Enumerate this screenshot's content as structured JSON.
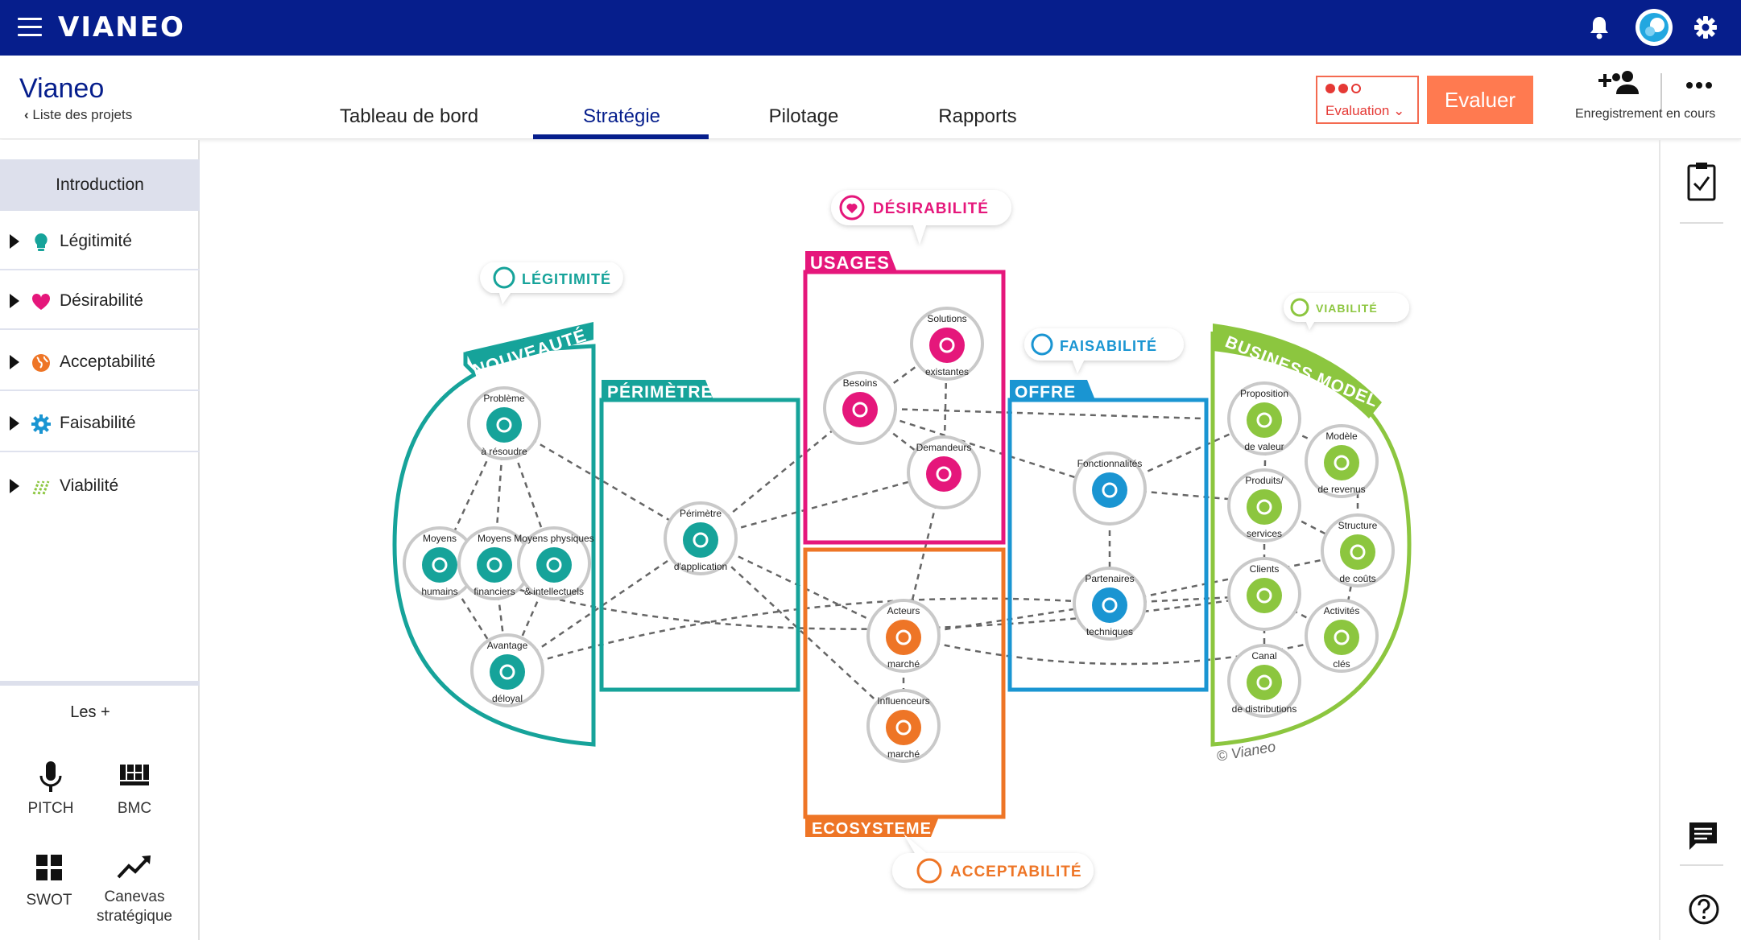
{
  "app": {
    "logo": "VIANEO"
  },
  "project": {
    "title": "Vianeo",
    "back_link": "Liste des projets"
  },
  "tabs": [
    {
      "label": "Tableau de bord"
    },
    {
      "label": "Stratégie"
    },
    {
      "label": "Pilotage"
    },
    {
      "label": "Rapports"
    }
  ],
  "active_tab": "Stratégie",
  "evaluation": {
    "label": "Evaluation",
    "level": 2,
    "max": 3
  },
  "evaluer_button": "Evaluer",
  "save_status": "Enregistrement en cours",
  "colors": {
    "brand": "#061e8c",
    "legitimite": "#16a39a",
    "desirabilite": "#e5177b",
    "acceptabilite": "#ee7526",
    "faisabilite": "#1a95d2",
    "viabilite": "#8cc63f",
    "accent": "#ff7a50"
  },
  "sidebar": {
    "intro": "Introduction",
    "items": [
      {
        "label": "Légitimité",
        "icon": "lightbulb-icon"
      },
      {
        "label": "Désirabilité",
        "icon": "heart-icon"
      },
      {
        "label": "Acceptabilité",
        "icon": "globe-icon"
      },
      {
        "label": "Faisabilité",
        "icon": "gear-icon"
      },
      {
        "label": "Viabilité",
        "icon": "sprout-icon"
      }
    ],
    "extras_title": "Les +",
    "tools": [
      {
        "label": "PITCH",
        "icon": "microphone-icon"
      },
      {
        "label": "BMC",
        "icon": "bmc-grid-icon"
      },
      {
        "label": "SWOT",
        "icon": "swot-grid-icon"
      },
      {
        "label": "Canevas stratégique",
        "icon": "trend-icon"
      }
    ]
  },
  "diagram": {
    "pillars": {
      "legitimite": "LÉGITIMITÉ",
      "desirabilite": "DÉSIRABILITÉ",
      "faisabilite": "FAISABILITÉ",
      "viabilite": "VIABILITÉ",
      "acceptabilite": "ACCEPTABILITÉ"
    },
    "blocks": {
      "nouveaute": "NOUVEAUTÉ",
      "perimetre": "PÉRIMÈTRE",
      "usages": "USAGES",
      "offre": "OFFRE",
      "business_model": "BUSINESS MODEL",
      "ecosysteme": "ECOSYSTEME"
    },
    "nodes": {
      "probleme": [
        "Problème",
        "à résoudre"
      ],
      "moyens_humains": [
        "Moyens",
        "humains"
      ],
      "moyens_financiers": [
        "Moyens",
        "financiers"
      ],
      "moyens_physiques": [
        "Moyens physiques",
        "& intellectuels"
      ],
      "avantage": [
        "Avantage",
        "déloyal"
      ],
      "perimetre_app": [
        "Périmètre",
        "d'application"
      ],
      "solutions": [
        "Solutions",
        "existantes"
      ],
      "besoins": [
        "Besoins",
        ""
      ],
      "demandeurs": [
        "Demandeurs",
        ""
      ],
      "acteurs": [
        "Acteurs",
        "marché"
      ],
      "influenceurs": [
        "Influenceurs",
        "marché"
      ],
      "fonctionnalites": [
        "Fonctionnalités",
        ""
      ],
      "partenaires": [
        "Partenaires",
        "techniques"
      ],
      "proposition": [
        "Proposition",
        "de valeur"
      ],
      "modele": [
        "Modèle",
        "de revenus"
      ],
      "produits": [
        "Produits/",
        "services"
      ],
      "structure": [
        "Structure",
        "de coûts"
      ],
      "clients": [
        "Clients",
        ""
      ],
      "activites": [
        "Activités",
        "clés"
      ],
      "canal": [
        "Canal",
        "de distributions"
      ]
    },
    "copyright": "© Vianeo"
  }
}
